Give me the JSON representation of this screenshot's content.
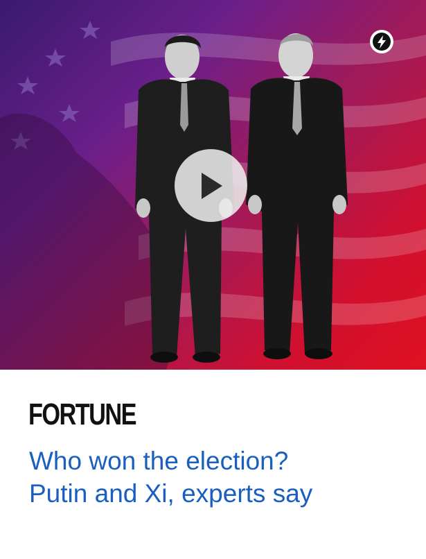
{
  "article": {
    "source": "FORTUNE",
    "headline_lines": [
      "Who won the election?",
      "Putin and Xi, experts say"
    ]
  },
  "icons": {
    "badge": "amp-lightning-icon",
    "play": "play-icon"
  },
  "colors": {
    "headline": "#1a5fc0",
    "logo": "#111111",
    "background_gradient": [
      "#3a1a6e",
      "#6a1f8a",
      "#a01a5a",
      "#d01030",
      "#e01020"
    ]
  }
}
